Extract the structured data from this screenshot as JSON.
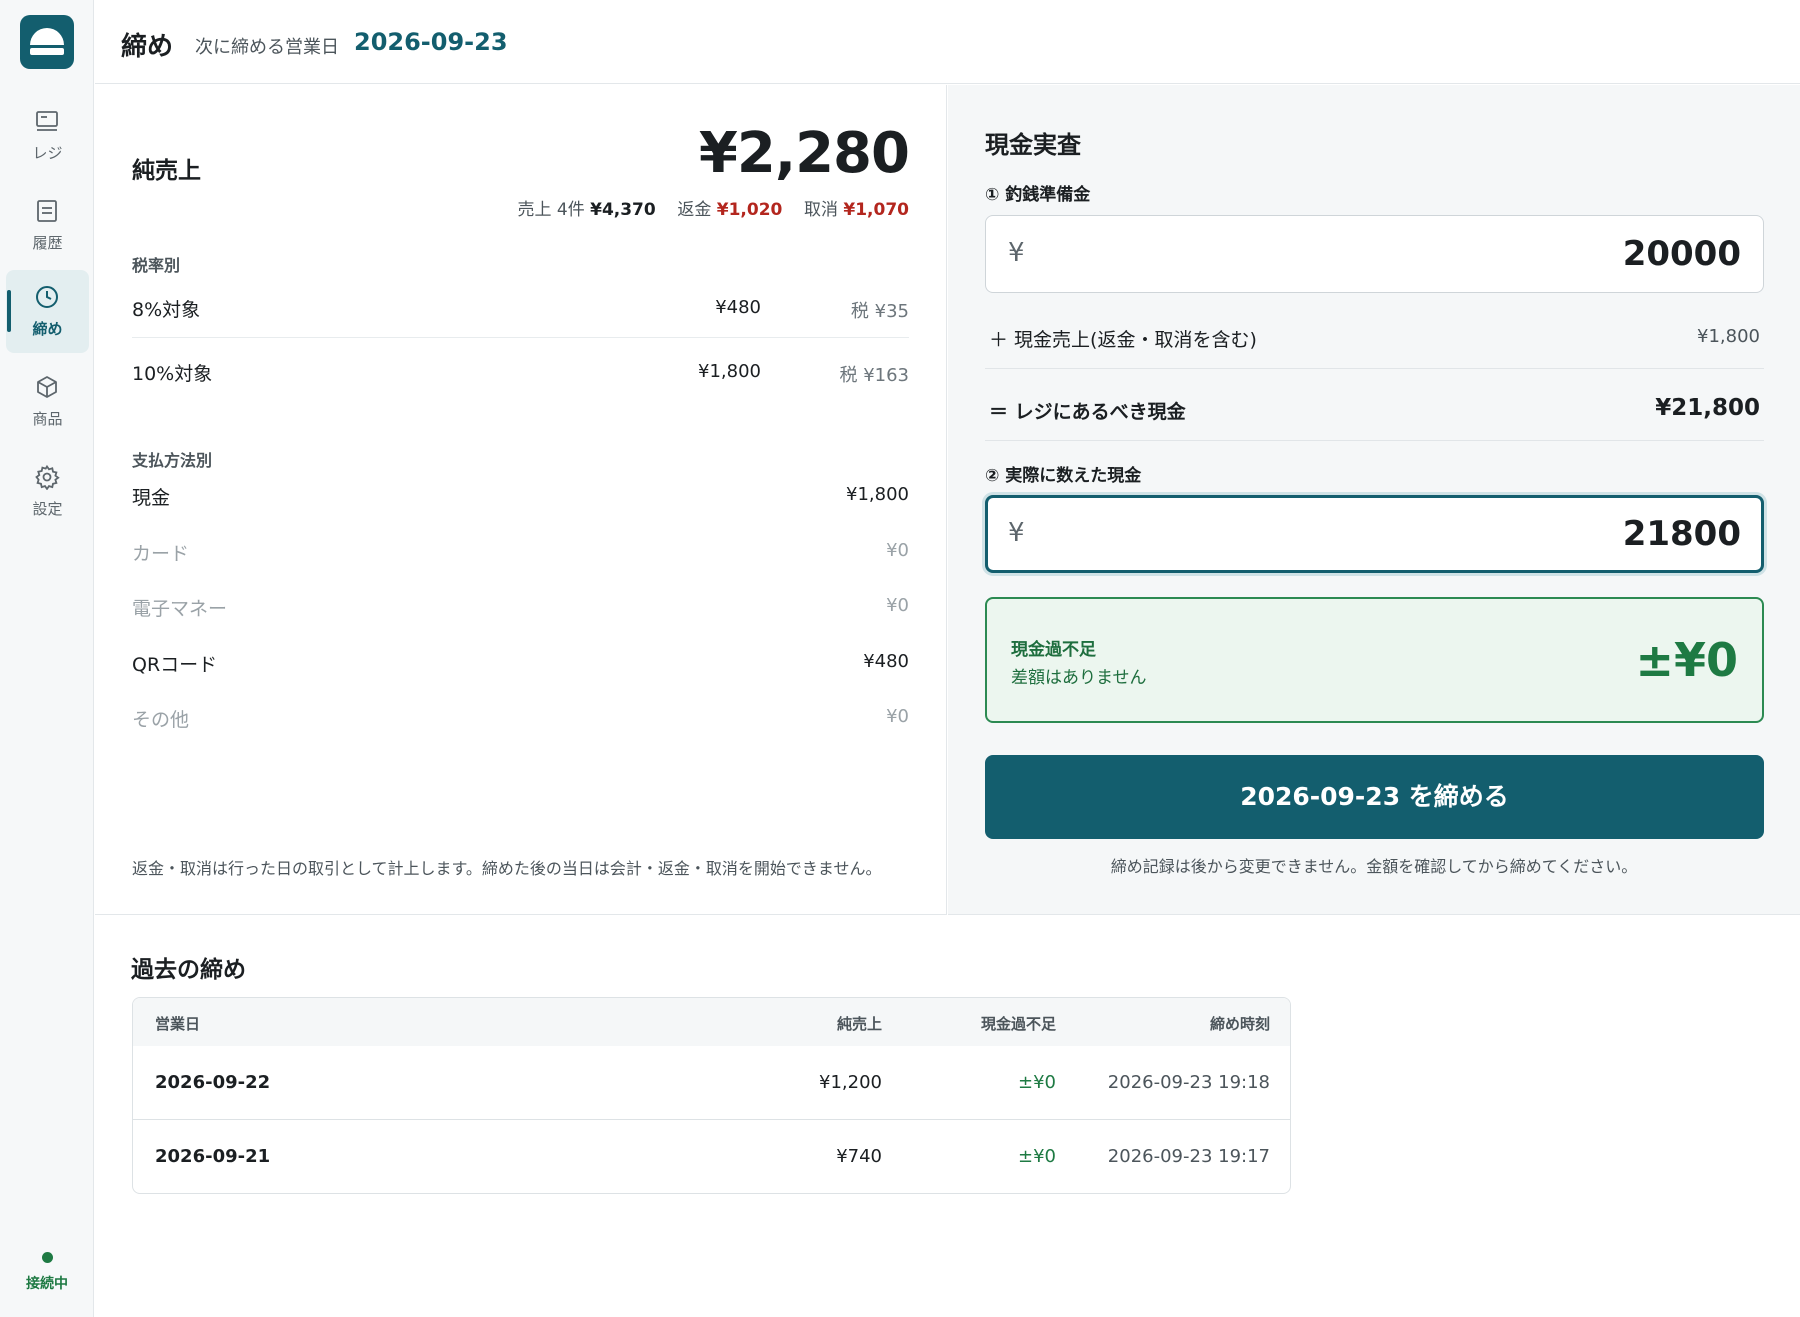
{
  "sidebar": {
    "items": [
      {
        "label": "レジ",
        "icon": "register-icon"
      },
      {
        "label": "履歴",
        "icon": "history-icon"
      },
      {
        "label": "締め",
        "icon": "clock-icon",
        "active": true
      },
      {
        "label": "商品",
        "icon": "box-icon"
      },
      {
        "label": "設定",
        "icon": "gear-icon"
      }
    ],
    "status_label": "接続中"
  },
  "header": {
    "title": "締め",
    "sub_label": "次に締める営業日",
    "date": "2026-09-23"
  },
  "summary": {
    "net_label": "純売上",
    "net_amount": "¥2,280",
    "sales_label": "売上 4件",
    "sales_amount": "¥4,370",
    "refund_label": "返金",
    "refund_amount": "¥1,020",
    "cancel_label": "取消",
    "cancel_amount": "¥1,070"
  },
  "tax": {
    "section_label": "税率別",
    "rows": [
      {
        "name": "8%対象",
        "amount": "¥480",
        "tax": "税 ¥35"
      },
      {
        "name": "10%対象",
        "amount": "¥1,800",
        "tax": "税 ¥163"
      }
    ]
  },
  "payments": {
    "section_label": "支払方法別",
    "rows": [
      {
        "name": "現金",
        "amount": "¥1,800"
      },
      {
        "name": "カード",
        "amount": "¥0"
      },
      {
        "name": "電子マネー",
        "amount": "¥0"
      },
      {
        "name": "QRコード",
        "amount": "¥480"
      },
      {
        "name": "その他",
        "amount": "¥0"
      }
    ]
  },
  "left_note": "返金・取消は行った日の取引として計上します。締めた後の当日は会計・返金・取消を開始できません。",
  "cash": {
    "title": "現金実査",
    "float_label": "① 釣銭準備金",
    "currency_symbol": "¥",
    "float_value": "20000",
    "cash_sales_label": "＋ 現金売上(返金・取消を含む)",
    "cash_sales_amount": "¥1,800",
    "expected_label": "＝ レジにあるべき現金",
    "expected_amount": "¥21,800",
    "counted_label": "② 実際に数えた現金",
    "counted_value": "21800",
    "diff_title": "現金過不足",
    "diff_message": "差額はありません",
    "diff_amount": "±¥0",
    "close_button": "2026-09-23 を締める",
    "note": "締め記録は後から変更できません。金額を確認してから締めてください。"
  },
  "history": {
    "title": "過去の締め",
    "columns": [
      "営業日",
      "純売上",
      "現金過不足",
      "締め時刻"
    ],
    "rows": [
      {
        "date": "2026-09-22",
        "sales": "¥1,200",
        "diff": "±¥0",
        "closed_at": "2026-09-23 19:18"
      },
      {
        "date": "2026-09-21",
        "sales": "¥740",
        "diff": "±¥0",
        "closed_at": "2026-09-23 19:17"
      }
    ]
  },
  "colors": {
    "brand": "#135e6e",
    "positive": "#1e7a43",
    "negative": "#b3261e"
  }
}
